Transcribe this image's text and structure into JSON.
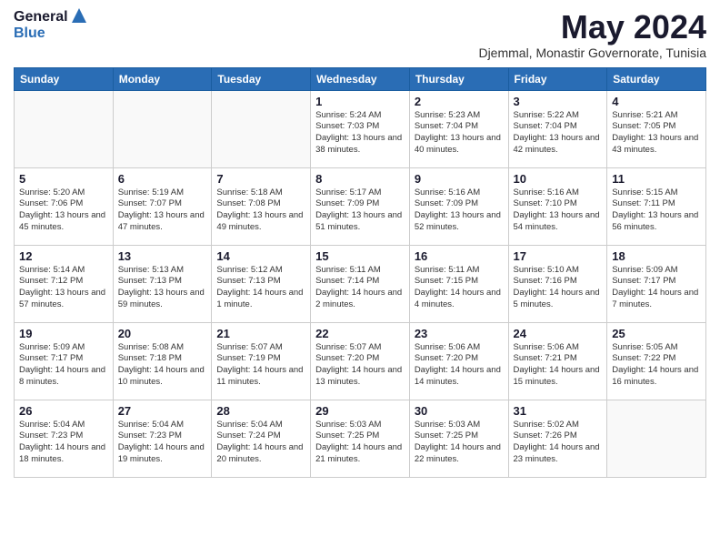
{
  "logo": {
    "general": "General",
    "blue": "Blue"
  },
  "title": "May 2024",
  "location": "Djemmal, Monastir Governorate, Tunisia",
  "weekdays": [
    "Sunday",
    "Monday",
    "Tuesday",
    "Wednesday",
    "Thursday",
    "Friday",
    "Saturday"
  ],
  "weeks": [
    [
      {
        "day": "",
        "info": ""
      },
      {
        "day": "",
        "info": ""
      },
      {
        "day": "",
        "info": ""
      },
      {
        "day": "1",
        "info": "Sunrise: 5:24 AM\nSunset: 7:03 PM\nDaylight: 13 hours\nand 38 minutes."
      },
      {
        "day": "2",
        "info": "Sunrise: 5:23 AM\nSunset: 7:04 PM\nDaylight: 13 hours\nand 40 minutes."
      },
      {
        "day": "3",
        "info": "Sunrise: 5:22 AM\nSunset: 7:04 PM\nDaylight: 13 hours\nand 42 minutes."
      },
      {
        "day": "4",
        "info": "Sunrise: 5:21 AM\nSunset: 7:05 PM\nDaylight: 13 hours\nand 43 minutes."
      }
    ],
    [
      {
        "day": "5",
        "info": "Sunrise: 5:20 AM\nSunset: 7:06 PM\nDaylight: 13 hours\nand 45 minutes."
      },
      {
        "day": "6",
        "info": "Sunrise: 5:19 AM\nSunset: 7:07 PM\nDaylight: 13 hours\nand 47 minutes."
      },
      {
        "day": "7",
        "info": "Sunrise: 5:18 AM\nSunset: 7:08 PM\nDaylight: 13 hours\nand 49 minutes."
      },
      {
        "day": "8",
        "info": "Sunrise: 5:17 AM\nSunset: 7:09 PM\nDaylight: 13 hours\nand 51 minutes."
      },
      {
        "day": "9",
        "info": "Sunrise: 5:16 AM\nSunset: 7:09 PM\nDaylight: 13 hours\nand 52 minutes."
      },
      {
        "day": "10",
        "info": "Sunrise: 5:16 AM\nSunset: 7:10 PM\nDaylight: 13 hours\nand 54 minutes."
      },
      {
        "day": "11",
        "info": "Sunrise: 5:15 AM\nSunset: 7:11 PM\nDaylight: 13 hours\nand 56 minutes."
      }
    ],
    [
      {
        "day": "12",
        "info": "Sunrise: 5:14 AM\nSunset: 7:12 PM\nDaylight: 13 hours\nand 57 minutes."
      },
      {
        "day": "13",
        "info": "Sunrise: 5:13 AM\nSunset: 7:13 PM\nDaylight: 13 hours\nand 59 minutes."
      },
      {
        "day": "14",
        "info": "Sunrise: 5:12 AM\nSunset: 7:13 PM\nDaylight: 14 hours\nand 1 minute."
      },
      {
        "day": "15",
        "info": "Sunrise: 5:11 AM\nSunset: 7:14 PM\nDaylight: 14 hours\nand 2 minutes."
      },
      {
        "day": "16",
        "info": "Sunrise: 5:11 AM\nSunset: 7:15 PM\nDaylight: 14 hours\nand 4 minutes."
      },
      {
        "day": "17",
        "info": "Sunrise: 5:10 AM\nSunset: 7:16 PM\nDaylight: 14 hours\nand 5 minutes."
      },
      {
        "day": "18",
        "info": "Sunrise: 5:09 AM\nSunset: 7:17 PM\nDaylight: 14 hours\nand 7 minutes."
      }
    ],
    [
      {
        "day": "19",
        "info": "Sunrise: 5:09 AM\nSunset: 7:17 PM\nDaylight: 14 hours\nand 8 minutes."
      },
      {
        "day": "20",
        "info": "Sunrise: 5:08 AM\nSunset: 7:18 PM\nDaylight: 14 hours\nand 10 minutes."
      },
      {
        "day": "21",
        "info": "Sunrise: 5:07 AM\nSunset: 7:19 PM\nDaylight: 14 hours\nand 11 minutes."
      },
      {
        "day": "22",
        "info": "Sunrise: 5:07 AM\nSunset: 7:20 PM\nDaylight: 14 hours\nand 13 minutes."
      },
      {
        "day": "23",
        "info": "Sunrise: 5:06 AM\nSunset: 7:20 PM\nDaylight: 14 hours\nand 14 minutes."
      },
      {
        "day": "24",
        "info": "Sunrise: 5:06 AM\nSunset: 7:21 PM\nDaylight: 14 hours\nand 15 minutes."
      },
      {
        "day": "25",
        "info": "Sunrise: 5:05 AM\nSunset: 7:22 PM\nDaylight: 14 hours\nand 16 minutes."
      }
    ],
    [
      {
        "day": "26",
        "info": "Sunrise: 5:04 AM\nSunset: 7:23 PM\nDaylight: 14 hours\nand 18 minutes."
      },
      {
        "day": "27",
        "info": "Sunrise: 5:04 AM\nSunset: 7:23 PM\nDaylight: 14 hours\nand 19 minutes."
      },
      {
        "day": "28",
        "info": "Sunrise: 5:04 AM\nSunset: 7:24 PM\nDaylight: 14 hours\nand 20 minutes."
      },
      {
        "day": "29",
        "info": "Sunrise: 5:03 AM\nSunset: 7:25 PM\nDaylight: 14 hours\nand 21 minutes."
      },
      {
        "day": "30",
        "info": "Sunrise: 5:03 AM\nSunset: 7:25 PM\nDaylight: 14 hours\nand 22 minutes."
      },
      {
        "day": "31",
        "info": "Sunrise: 5:02 AM\nSunset: 7:26 PM\nDaylight: 14 hours\nand 23 minutes."
      },
      {
        "day": "",
        "info": ""
      }
    ]
  ]
}
